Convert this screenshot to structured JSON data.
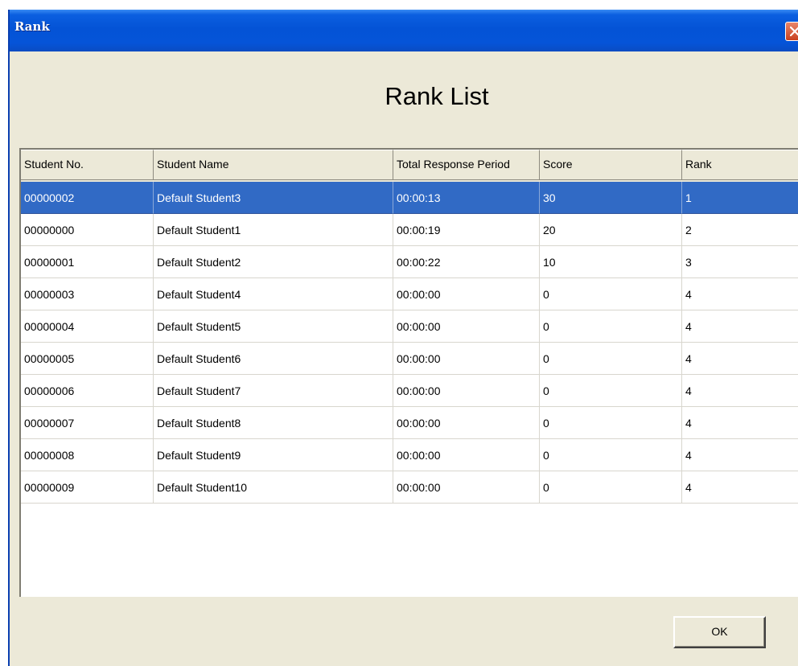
{
  "window": {
    "title": "Rank",
    "close_icon": "close-icon"
  },
  "heading": "Rank List",
  "table": {
    "columns": [
      "Student No.",
      "Student Name",
      "Total Response Period",
      "Score",
      "Rank"
    ],
    "rows": [
      [
        "00000002",
        "Default Student3",
        "00:00:13",
        "30",
        "1"
      ],
      [
        "00000000",
        "Default Student1",
        "00:00:19",
        "20",
        "2"
      ],
      [
        "00000001",
        "Default Student2",
        "00:00:22",
        "10",
        "3"
      ],
      [
        "00000003",
        "Default Student4",
        "00:00:00",
        "0",
        "4"
      ],
      [
        "00000004",
        "Default Student5",
        "00:00:00",
        "0",
        "4"
      ],
      [
        "00000005",
        "Default Student6",
        "00:00:00",
        "0",
        "4"
      ],
      [
        "00000006",
        "Default Student7",
        "00:00:00",
        "0",
        "4"
      ],
      [
        "00000007",
        "Default Student8",
        "00:00:00",
        "0",
        "4"
      ],
      [
        "00000008",
        "Default Student9",
        "00:00:00",
        "0",
        "4"
      ],
      [
        "00000009",
        "Default Student10",
        "00:00:00",
        "0",
        "4"
      ]
    ]
  },
  "buttons": {
    "ok_label": "OK"
  },
  "colors": {
    "title_bar": "#0453d6",
    "selection": "#316ac5",
    "dialog_bg": "#ece9d8"
  }
}
